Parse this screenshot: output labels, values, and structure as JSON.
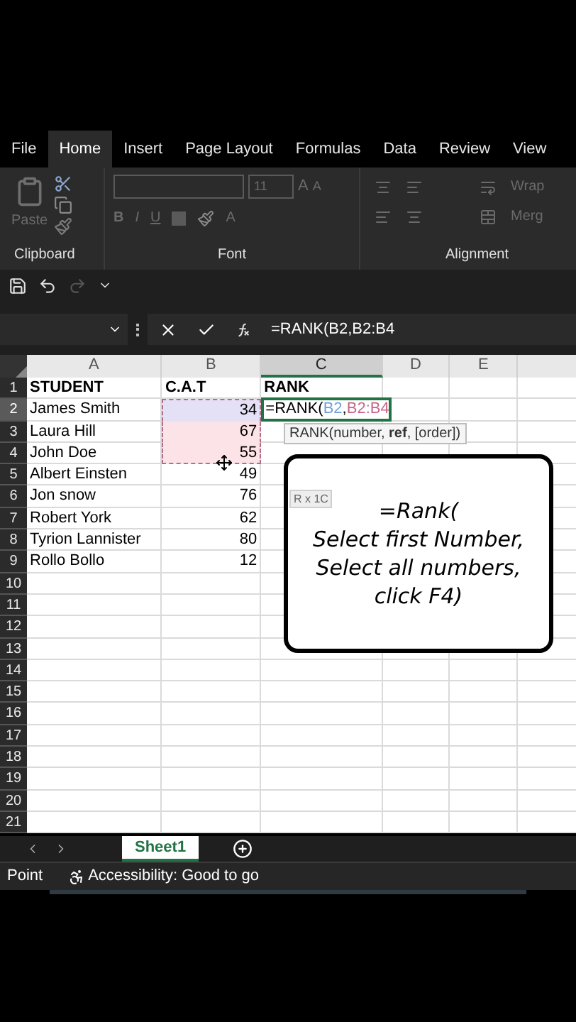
{
  "ribbon": {
    "tabs": [
      {
        "label": "File",
        "selected": false
      },
      {
        "label": "Home",
        "selected": true
      },
      {
        "label": "Insert",
        "selected": false
      },
      {
        "label": "Page Layout",
        "selected": false
      },
      {
        "label": "Formulas",
        "selected": false
      },
      {
        "label": "Data",
        "selected": false
      },
      {
        "label": "Review",
        "selected": false
      },
      {
        "label": "View",
        "selected": false
      }
    ],
    "clipboard": {
      "paste_label": "Paste",
      "group_label": "Clipboard"
    },
    "font": {
      "size": "11",
      "bold_label": "B",
      "italic_label": "I",
      "underline_label": "U",
      "grow_label": "A",
      "shrink_label": "A",
      "color_label": "A",
      "group_label": "Font"
    },
    "alignment": {
      "wrap_label": "Wrap",
      "merge_label": "Merg",
      "group_label": "Alignment"
    }
  },
  "formula_bar": {
    "formula": "=RANK(B2,B2:B4"
  },
  "sheet": {
    "columns": [
      {
        "label": "A",
        "selected": false
      },
      {
        "label": "B",
        "selected": false
      },
      {
        "label": "C",
        "selected": true
      },
      {
        "label": "D",
        "selected": false
      },
      {
        "label": "E",
        "selected": false
      }
    ],
    "rows": [
      {
        "number": "1",
        "selected": false,
        "bold": true,
        "student": "STUDENT",
        "cat": "C.A.T",
        "rank": "RANK"
      },
      {
        "number": "2",
        "selected": true,
        "bold": false,
        "student": "James Smith",
        "cat": "34",
        "in_reference": true,
        "rank_edit": [
          {
            "text": "=RANK("
          },
          {
            "text": "B2",
            "color": "#6f9fd8"
          },
          {
            "text": ","
          },
          {
            "text": "B2:B4",
            "color": "#c8668a"
          }
        ]
      },
      {
        "number": "3",
        "selected": false,
        "bold": false,
        "student": "Laura Hill",
        "cat": "67",
        "in_reference": true
      },
      {
        "number": "4",
        "selected": false,
        "bold": false,
        "student": "John Doe",
        "cat": "55",
        "in_reference": true
      },
      {
        "number": "5",
        "selected": false,
        "bold": false,
        "student": "Albert Einsten",
        "cat": "49"
      },
      {
        "number": "6",
        "selected": false,
        "bold": false,
        "student": "Jon snow",
        "cat": "76"
      },
      {
        "number": "7",
        "selected": false,
        "bold": false,
        "student": "Robert York",
        "cat": "62"
      },
      {
        "number": "8",
        "selected": false,
        "bold": false,
        "student": "Tyrion Lannister",
        "cat": "80"
      },
      {
        "number": "9",
        "selected": false,
        "bold": false,
        "student": "Rollo Bollo",
        "cat": "12"
      },
      {
        "number": "10",
        "selected": false
      },
      {
        "number": "11",
        "selected": false
      },
      {
        "number": "12",
        "selected": false
      },
      {
        "number": "13",
        "selected": false
      },
      {
        "number": "14",
        "selected": false
      },
      {
        "number": "15",
        "selected": false
      },
      {
        "number": "16",
        "selected": false
      },
      {
        "number": "17",
        "selected": false
      },
      {
        "number": "18",
        "selected": false
      },
      {
        "number": "19",
        "selected": false
      },
      {
        "number": "20",
        "selected": false
      },
      {
        "number": "21",
        "selected": false
      }
    ],
    "function_tip": "RANK(number, **ref**, [order])",
    "size_tip": "R x 1C"
  },
  "note": {
    "lines": [
      "=Rank(",
      "Select first Number,",
      "Select all numbers,",
      "click F4)"
    ]
  },
  "sheet_tabs": [
    {
      "label": "Sheet1",
      "selected": true
    }
  ],
  "status_bar": {
    "mode": "Point",
    "accessibility": "Accessibility: Good to go"
  }
}
